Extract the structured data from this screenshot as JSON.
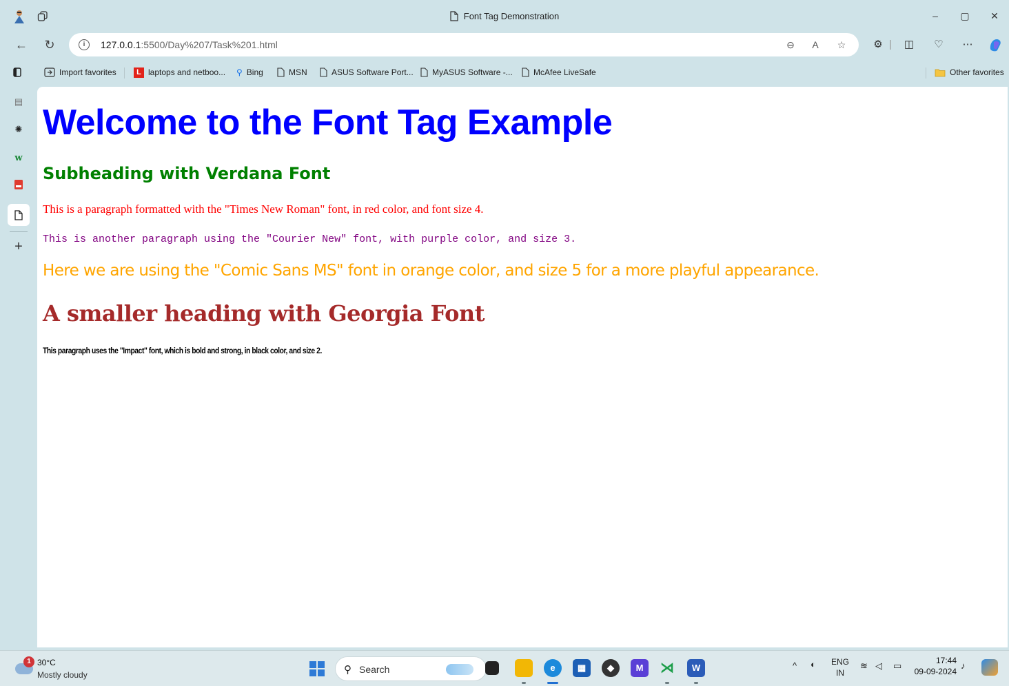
{
  "window": {
    "tab_title": "Font Tag Demonstration",
    "controls": {
      "minimize": "–",
      "maximize": "▢",
      "close": "✕"
    }
  },
  "nav": {
    "back_icon": "back-arrow-icon",
    "refresh_icon": "refresh-icon",
    "url_host": "127.0.0.1",
    "url_path": ":5500/Day%207/Task%201.html"
  },
  "favorites": [
    {
      "label": "Import favorites",
      "icon": "import-icon"
    },
    {
      "label": "laptops and netboo...",
      "icon": "lenovo-icon"
    },
    {
      "label": "Bing",
      "icon": "search-icon"
    },
    {
      "label": "MSN",
      "icon": "page-icon"
    },
    {
      "label": "ASUS Software Port...",
      "icon": "page-icon"
    },
    {
      "label": "MyASUS Software -...",
      "icon": "page-icon"
    },
    {
      "label": "McAfee LiveSafe",
      "icon": "page-icon"
    }
  ],
  "other_favorites": "Other favorites",
  "page": {
    "h1": "Welcome to the Font Tag Example",
    "h2": "Subheading with Verdana Font",
    "p_times": "This is a paragraph formatted with the \"Times New Roman\" font, in red color, and font size 4.",
    "p_courier": "This is another paragraph using the \"Courier New\" font, with purple color, and size 3.",
    "p_comic": "Here we are using the \"Comic Sans MS\" font in orange color, and size 5 for a more playful appearance.",
    "h3": "A smaller heading with Georgia Font",
    "p_impact": "This paragraph uses the \"Impact\" font, which is bold and strong, in black color, and size 2."
  },
  "colors": {
    "h1": "#0000ff",
    "h2": "#008000",
    "p_times": "#ff0000",
    "p_courier": "#800080",
    "p_comic": "#ffa500",
    "h3": "#a52a2a",
    "p_impact": "#000000"
  },
  "taskbar": {
    "weather_badge": "1",
    "temperature": "30°C",
    "condition": "Mostly cloudy",
    "search_label": "Search",
    "language_top": "ENG",
    "language_bottom": "IN",
    "time": "17:44",
    "date": "09-09-2024"
  }
}
